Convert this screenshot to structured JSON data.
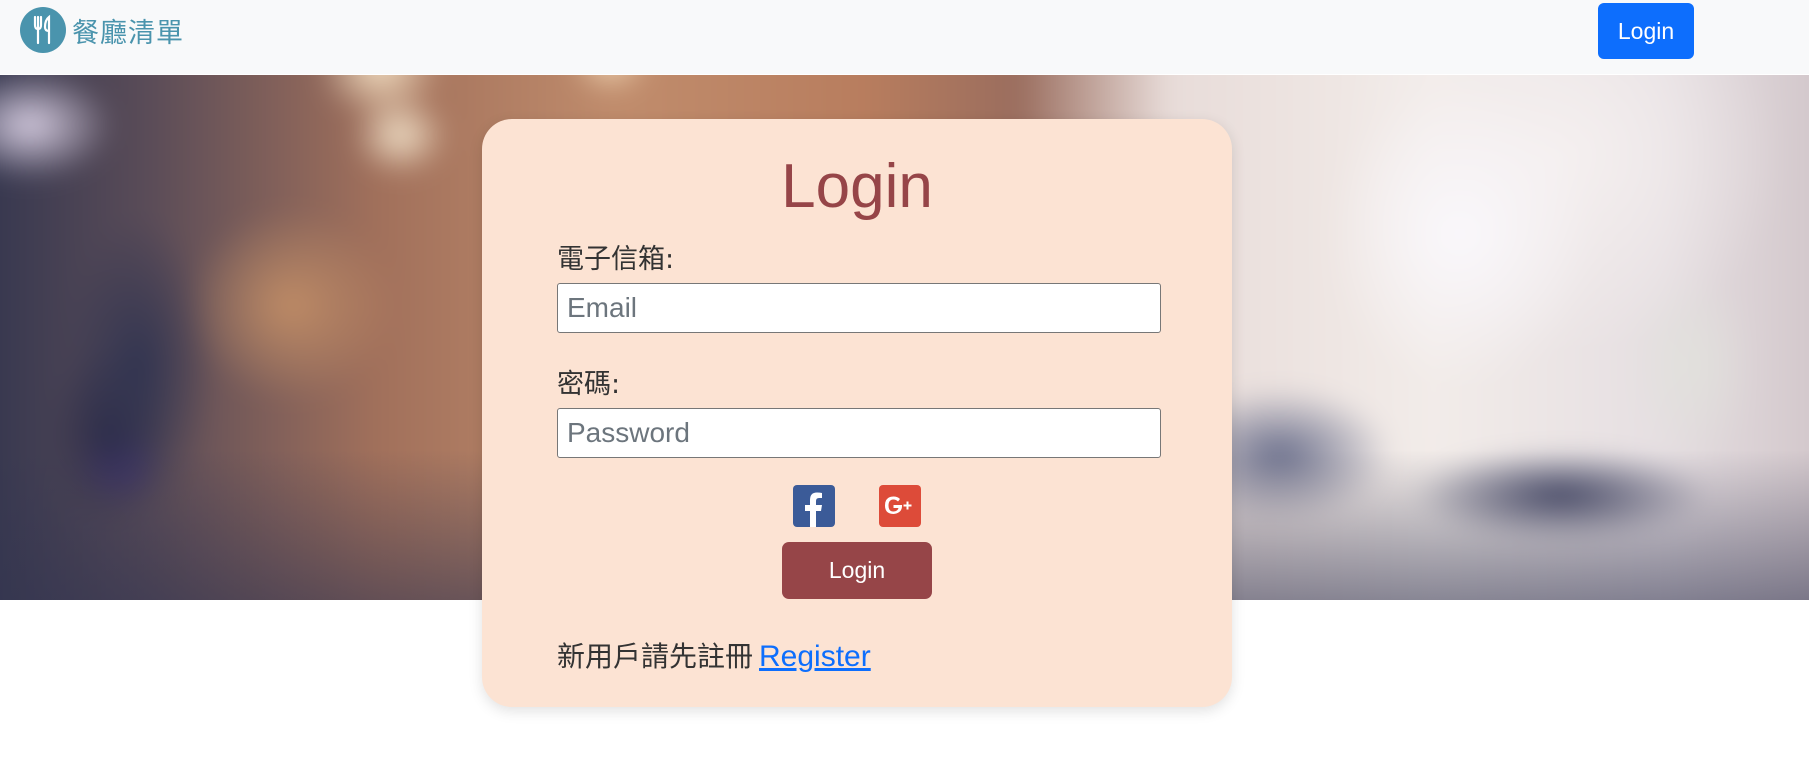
{
  "navbar": {
    "brand_text": "餐廳清單",
    "brand_icon": "fork-knife-icon",
    "login_label": "Login",
    "accent_color": "#0d6efd",
    "brand_color": "#4a94ad"
  },
  "card": {
    "title": "Login",
    "email_label": "電子信箱:",
    "email_placeholder": "Email",
    "email_value": "",
    "password_label": "密碼:",
    "password_placeholder": "Password",
    "password_value": "",
    "social": [
      {
        "icon": "facebook-icon",
        "color": "#3b5b98"
      },
      {
        "icon": "google-plus-icon",
        "color": "#dd4b39"
      }
    ],
    "login_label": "Login",
    "register_prompt": "新用戶請先註冊",
    "register_link": "Register",
    "card_color": "#fce3d3",
    "button_color": "#964548"
  }
}
